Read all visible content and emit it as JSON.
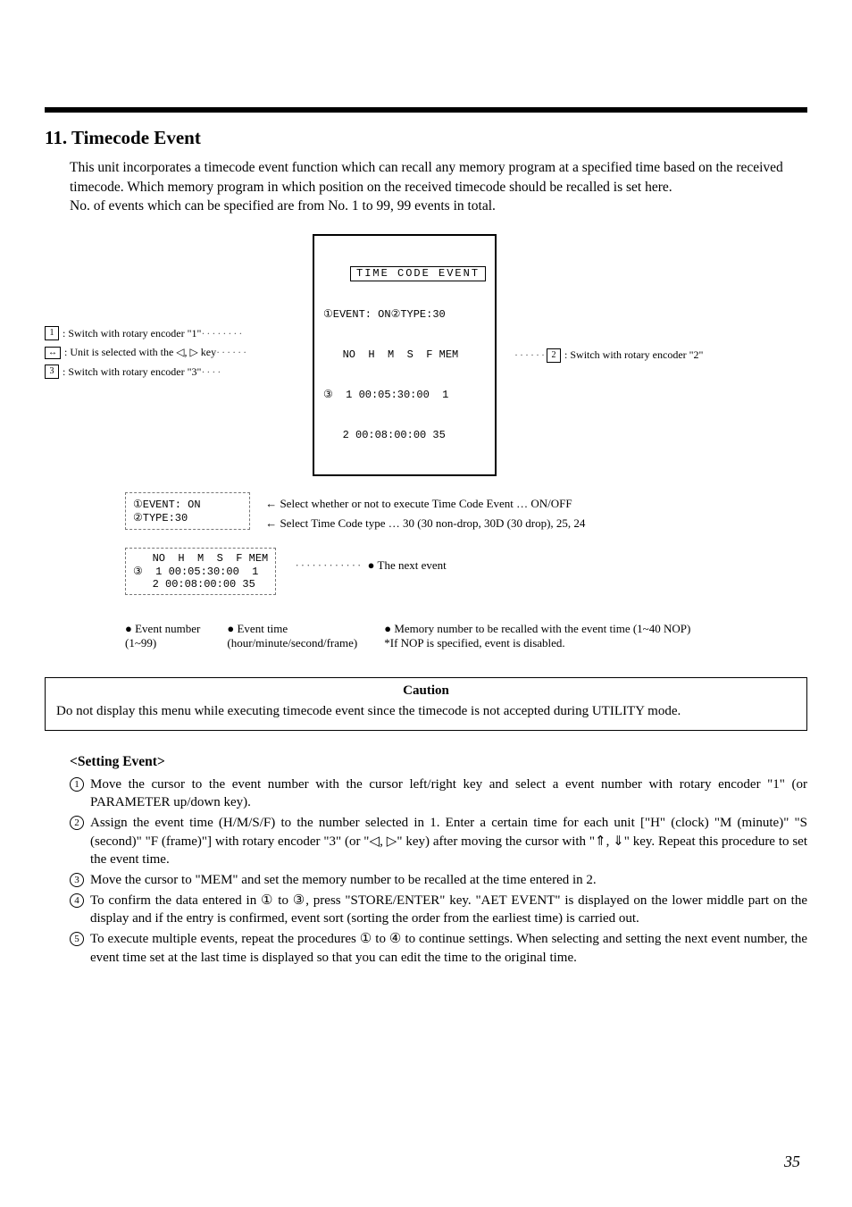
{
  "heading": "11. Timecode Event",
  "intro": {
    "p1": "This unit incorporates a timecode event function which can recall any memory program at a specified time based on the received timecode. Which memory program in which position on the received timecode should be recalled is set here.",
    "p2": "No. of events which can be specified are from No. 1 to 99, 99 events in total."
  },
  "diagram": {
    "label1": ": Switch with rotary encoder \"1\"",
    "label_arrow": ": Unit is selected with the ◁, ▷ key",
    "label3": ": Switch with rotary encoder \"3\"",
    "label2": ": Switch with rotary encoder \"2\"",
    "screen_title": "TIME CODE EVENT",
    "screen_line1": "①EVENT: ON②TYPE:30",
    "screen_header": "   NO  H  M  S  F MEM",
    "screen_row1": "③  1 00:05:30:00  1",
    "screen_row2": "   2 00:08:00:00 35",
    "box_event": "①EVENT: ON",
    "box_type": "②TYPE:30",
    "explain_event": "←   Select whether or not to execute Time Code Event … ON/OFF",
    "explain_type": "←   Select Time Code type … 30 (30 non-drop, 30D (30 drop), 25, 24",
    "evt_header": "   NO  H  M  S  F MEM",
    "evt_row1": "③  1 00:05:30:00  1",
    "evt_row2": "   2 00:08:00:00 35",
    "next_event": "● The next event",
    "b_evtnum1": "● Event number",
    "b_evtnum2": "(1~99)",
    "b_evttime1": "● Event time",
    "b_evttime2": "(hour/minute/second/frame)",
    "b_mem1": "● Memory number to be recalled with the event time (1~40 NOP)",
    "b_mem2": "*If NOP is specified, event is disabled."
  },
  "caution": {
    "title": "Caution",
    "text": "Do not display this menu while executing timecode event since the timecode is not accepted during UTILITY mode."
  },
  "setting_heading": "<Setting Event>",
  "steps": {
    "s1": "Move the cursor to the event number with the cursor left/right key and select a event number with rotary encoder \"1\" (or PARAMETER up/down key).",
    "s2": "Assign the event time (H/M/S/F) to the number selected in 1. Enter a certain time for each unit [\"H\" (clock) \"M (minute)\" \"S (second)\" \"F (frame)\"] with rotary encoder \"3\" (or \"◁, ▷\" key) after moving the cursor with \"⇑, ⇓\" key. Repeat this procedure to set the event time.",
    "s3": "Move the cursor to \"MEM\" and set the memory number to be recalled at the time entered in 2.",
    "s4": "To confirm the data entered in ① to ③, press \"STORE/ENTER\" key. \"AET EVENT\" is displayed on the lower middle part on the display and if the entry is confirmed, event sort (sorting the order from the earliest time) is carried out.",
    "s5": "To execute multiple events, repeat the procedures ① to ④ to continue settings. When selecting and setting the next event number, the event time set at the last time is displayed so that you can edit the time to the original time."
  },
  "page_number": "35"
}
